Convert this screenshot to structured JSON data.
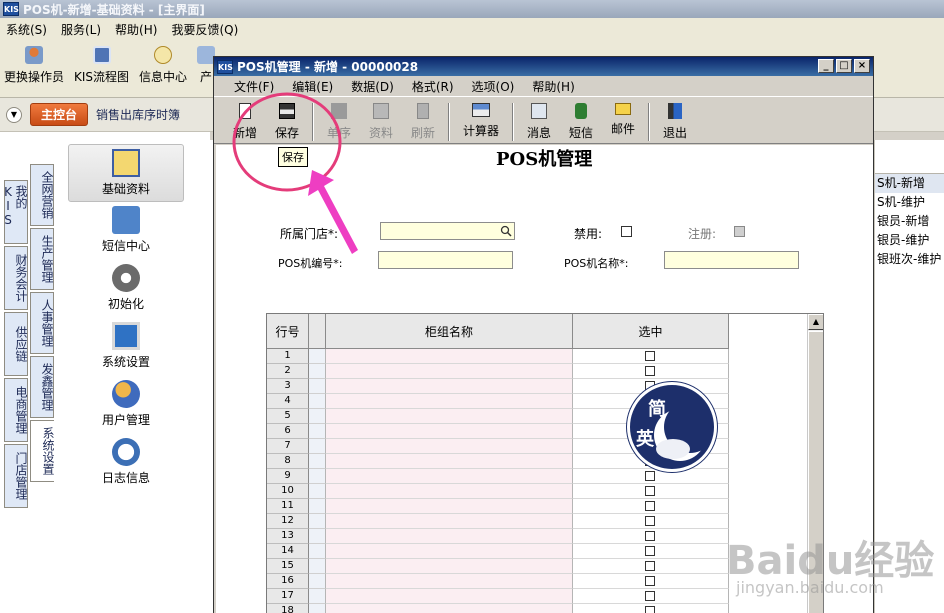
{
  "main_window": {
    "title": "POS机-新增-基础资料 - [主界面]",
    "logo": "KIS",
    "menu": [
      "系统(S)",
      "服务(L)",
      "帮助(H)",
      "我要反馈(Q)"
    ],
    "toolbar": [
      {
        "label": "更换操作员",
        "icon": "user-switch-icon"
      },
      {
        "label": "KIS流程图",
        "icon": "flowchart-icon"
      },
      {
        "label": "信息中心",
        "icon": "message-icon"
      },
      {
        "label": "产",
        "icon": "product-icon"
      }
    ],
    "nav": {
      "home_label": "主控台",
      "text": "销售出库序时簿"
    },
    "vtabs_outer": [
      "我的KIS",
      "财务会计",
      "供应链",
      "电商管理",
      "门店管理"
    ],
    "vtabs_inner": [
      "全网营销",
      "生产管理",
      "人事管理",
      "发鑫管理",
      "系统设置"
    ],
    "left_items": [
      {
        "label": "基础资料",
        "icon": "basic-data-icon"
      },
      {
        "label": "短信中心",
        "icon": "sms-center-icon"
      },
      {
        "label": "初始化",
        "icon": "initialize-gear-icon"
      },
      {
        "label": "系统设置",
        "icon": "system-settings-icon"
      },
      {
        "label": "用户管理",
        "icon": "user-management-icon"
      },
      {
        "label": "日志信息",
        "icon": "log-info-icon"
      }
    ],
    "right_list": [
      "S机-新增",
      "S机-维护",
      "银员-新增",
      "银员-维护",
      "银班次-维护"
    ]
  },
  "dialog": {
    "logo": "KIS",
    "title": "POS机管理 - 新增 - 00000028",
    "menu": [
      "文件(F)",
      "编辑(E)",
      "数据(D)",
      "格式(R)",
      "选项(O)",
      "帮助(H)"
    ],
    "toolbar": [
      {
        "label": "新增",
        "icon": "new-document-icon",
        "enabled": true
      },
      {
        "label": "保存",
        "icon": "save-disk-icon",
        "enabled": true
      },
      {
        "label": "单序",
        "icon": "sequence-icon",
        "enabled": false
      },
      {
        "label": "资料",
        "icon": "data-icon",
        "enabled": false
      },
      {
        "label": "刷新",
        "icon": "refresh-icon",
        "enabled": false
      },
      {
        "label": "计算器",
        "icon": "calculator-icon",
        "enabled": true
      },
      {
        "label": "消息",
        "icon": "message-icon",
        "enabled": true
      },
      {
        "label": "短信",
        "icon": "sms-icon",
        "enabled": true
      },
      {
        "label": "邮件",
        "icon": "mail-icon",
        "enabled": true
      },
      {
        "label": "退出",
        "icon": "exit-icon",
        "enabled": true
      }
    ],
    "tooltip": "保存",
    "form": {
      "title": "POS机管理",
      "store_label": "所属门店*:",
      "disabled_label": "禁用:",
      "register_label": "注册:",
      "pos_code_label": "POS机编号*:",
      "pos_name_label": "POS机名称*:",
      "store_value": "",
      "pos_code_value": "",
      "pos_name_value": ""
    },
    "grid": {
      "headers": [
        "行号",
        "柜组名称",
        "选中"
      ],
      "rows": [
        "1",
        "2",
        "3",
        "4",
        "5",
        "6",
        "7",
        "8",
        "9",
        "10",
        "11",
        "12",
        "13",
        "14",
        "15",
        "16",
        "17",
        "18"
      ]
    }
  },
  "watermark": {
    "badge_chars": [
      "简",
      "英"
    ],
    "site": "Baidu经验",
    "site_url_text": "jingyan.baidu.com"
  },
  "colors": {
    "dialog_title": "#0a246a",
    "input_bg": "#ffffde",
    "annotation": "#e43c7a",
    "nav_pill": "#d85a20"
  }
}
